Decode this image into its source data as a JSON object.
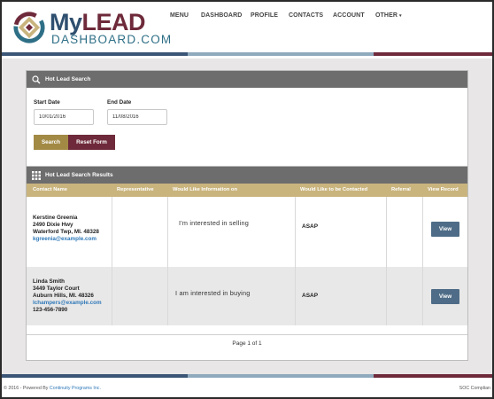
{
  "brand": {
    "logo_my": "My",
    "logo_lead": "LEAD",
    "logo_sub": "DASHBOARD.COM"
  },
  "nav": {
    "items": [
      "MENU",
      "DASHBOARD",
      "PROFILE",
      "CONTACTS",
      "ACCOUNT",
      "OTHER"
    ]
  },
  "search_panel": {
    "title": "Hot Lead Search",
    "start_date_label": "Start Date",
    "start_date_value": "10/01/2016",
    "end_date_label": "End Date",
    "end_date_value": "11/08/2016",
    "search_button": "Search",
    "reset_button": "Reset Form"
  },
  "results_panel": {
    "title": "Hot Lead Search Results",
    "columns": [
      "Contact Name",
      "Representative",
      "Would Like Information on",
      "Would Like to be Contacted",
      "Referral",
      "View Record"
    ],
    "rows": [
      {
        "name": "Kerstine Greenia",
        "address1": "2490 Dixie Hwy",
        "address2": "Waterford Twp, MI. 48328",
        "email": "kgreenia@example.com",
        "phone": "",
        "interest": "I'm interested in selling",
        "contact": "ASAP",
        "view_label": "View"
      },
      {
        "name": "Linda Smith",
        "address1": "3449 Taylor Court",
        "address2": "Auburn Hills, MI. 48326",
        "email": "lchampers@example.com",
        "phone": "123-456-7890",
        "interest": "I am interested in buying",
        "contact": "ASAP",
        "view_label": "View"
      }
    ],
    "pager": "Page 1 of 1"
  },
  "footer": {
    "copyright": "© 2016 - Powered By",
    "company": "Continuity Programs Inc.",
    "right_text": "SOC Complian"
  },
  "colors": {
    "navy": "#3a5576",
    "maroon": "#6e2a3a",
    "gold": "#c9b47e",
    "panel_header": "#6d6d6d"
  }
}
